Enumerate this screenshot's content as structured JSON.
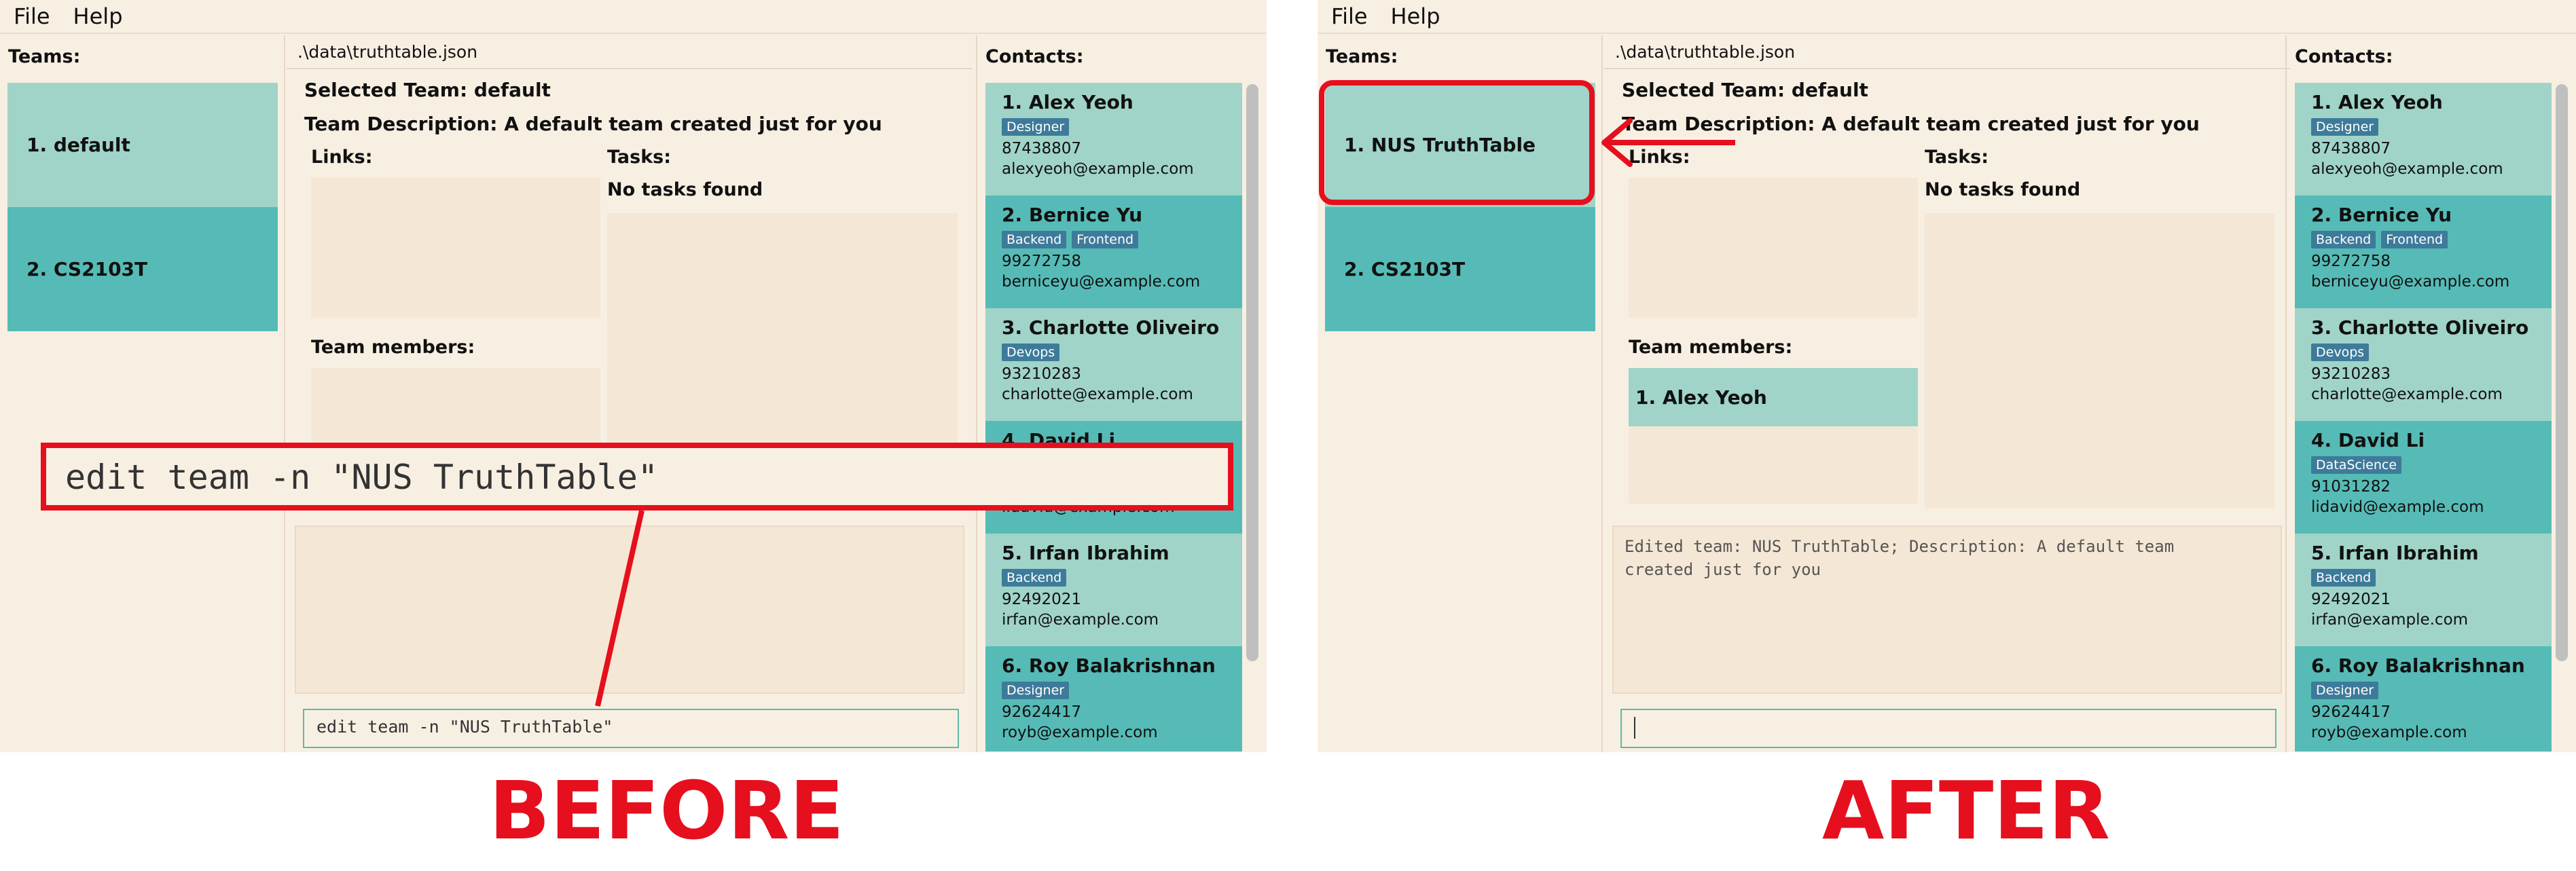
{
  "menu": {
    "file": "File",
    "help": "Help"
  },
  "teams_title": "Teams:",
  "contacts_title": "Contacts:",
  "before": {
    "file_path": ".\\data\\truthtable.json",
    "teams": [
      "1. default",
      "2. CS2103T"
    ],
    "selected_team": "Selected Team: default",
    "team_description": "Team Description: A default team created just for you",
    "links_label": "Links:",
    "tasks_label": "Tasks:",
    "no_tasks": "No tasks found",
    "members_label": "Team members:",
    "result": "",
    "command": "edit team -n \"NUS TruthTable\""
  },
  "after": {
    "file_path": ".\\data\\truthtable.json",
    "teams": [
      "1. NUS TruthTable",
      "2. CS2103T"
    ],
    "selected_team": "Selected Team: default",
    "team_description": "Team Description: A default team created just for you",
    "links_label": "Links:",
    "tasks_label": "Tasks:",
    "no_tasks": "No tasks found",
    "members_label": "Team members:",
    "members": [
      "1. Alex Yeoh"
    ],
    "result": "Edited team: NUS TruthTable; Description: A default team\ncreated just for you",
    "command": ""
  },
  "contacts": [
    {
      "name": "1. Alex Yeoh",
      "tags": [
        "Designer"
      ],
      "phone": "87438807",
      "email": "alexyeoh@example.com"
    },
    {
      "name": "2. Bernice Yu",
      "tags": [
        "Backend",
        "Frontend"
      ],
      "phone": "99272758",
      "email": "berniceyu@example.com"
    },
    {
      "name": "3. Charlotte Oliveiro",
      "tags": [
        "Devops"
      ],
      "phone": "93210283",
      "email": "charlotte@example.com"
    },
    {
      "name": "4. David Li",
      "tags": [
        "DataScience"
      ],
      "phone": "91031282",
      "email": "lidavid@example.com"
    },
    {
      "name": "5. Irfan Ibrahim",
      "tags": [
        "Backend"
      ],
      "phone": "92492021",
      "email": "irfan@example.com"
    },
    {
      "name": "6. Roy Balakrishnan",
      "tags": [
        "Designer"
      ],
      "phone": "92624417",
      "email": "royb@example.com"
    }
  ],
  "annotations": {
    "overlay_command": "edit team -n \"NUS TruthTable\"",
    "before_caption": "BEFORE",
    "after_caption": "AFTER",
    "color": "#e60f1d"
  }
}
